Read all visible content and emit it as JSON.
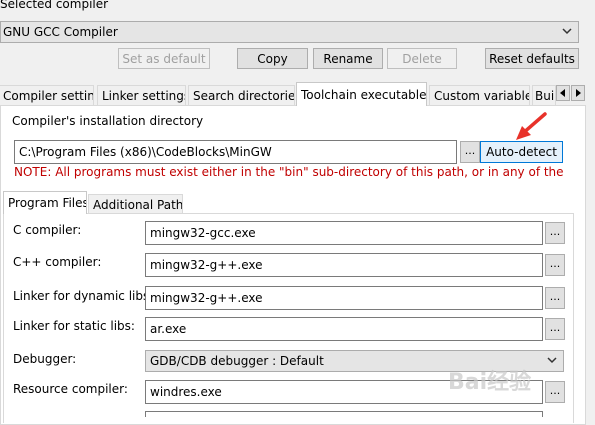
{
  "selected_compiler": {
    "label": "Selected compiler",
    "value": "GNU GCC Compiler"
  },
  "toolbar": {
    "set_default": "Set as default",
    "copy": "Copy",
    "rename": "Rename",
    "delete": "Delete",
    "reset_defaults": "Reset defaults"
  },
  "tabs": {
    "compiler_settings": "Compiler settings",
    "linker_settings": "Linker settings",
    "search_directories": "Search directories",
    "toolchain_executables": "Toolchain executables",
    "custom_variables": "Custom variables",
    "build_options": "Bui"
  },
  "install_dir": {
    "label": "Compiler's installation directory",
    "value": "C:\\Program Files (x86)\\CodeBlocks\\MinGW",
    "browse": "...",
    "auto_detect": "Auto-detect",
    "note": "NOTE: All programs must exist either in the \"bin\" sub-directory of this path, or in any of the"
  },
  "subtabs": {
    "program_files": "Program Files",
    "additional_paths": "Additional Paths"
  },
  "programs": [
    {
      "label": "C compiler:",
      "value": "mingw32-gcc.exe"
    },
    {
      "label": "C++ compiler:",
      "value": "mingw32-g++.exe"
    },
    {
      "label": "Linker for dynamic libs:",
      "value": "mingw32-g++.exe"
    },
    {
      "label": "Linker for static libs:",
      "value": "ar.exe"
    },
    {
      "label": "Debugger:",
      "value": "GDB/CDB debugger : Default"
    },
    {
      "label": "Resource compiler:",
      "value": "windres.exe"
    }
  ],
  "browse_label": "...",
  "watermark": "Bai经验",
  "colors": {
    "accent": "#0078d7",
    "note_text": "#c00000",
    "arrow": "#e8322a"
  }
}
